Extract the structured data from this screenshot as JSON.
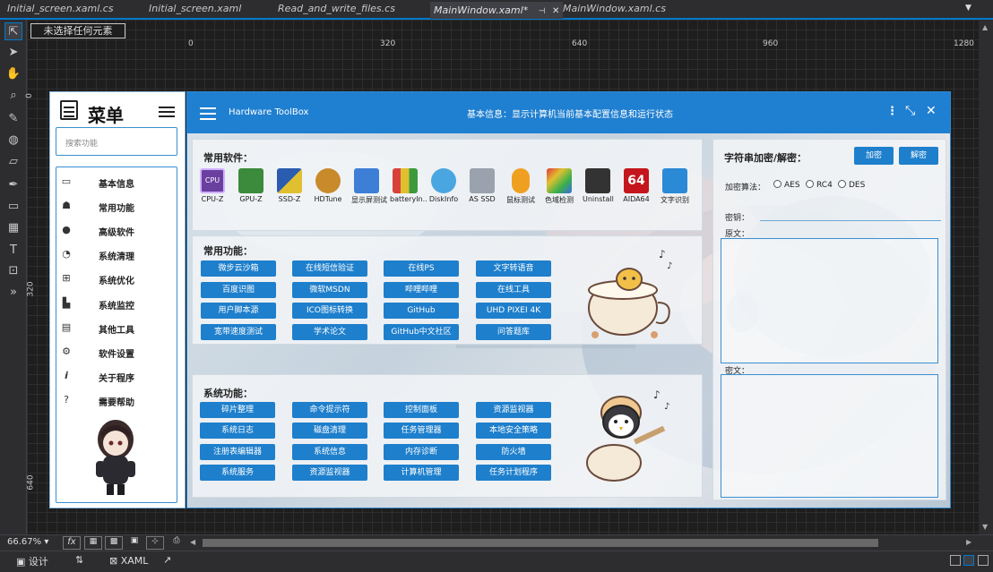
{
  "tabs": [
    {
      "label": "Initial_screen.xaml.cs",
      "active": false
    },
    {
      "label": "Initial_screen.xaml",
      "active": false
    },
    {
      "label": "Read_and_write_files.cs",
      "active": false
    },
    {
      "label": "MainWindow.xaml*",
      "active": true
    },
    {
      "label": "MainWindow.xaml.cs",
      "active": false
    }
  ],
  "selection_status": "未选择任何元素",
  "ruler": {
    "h": [
      "0",
      "320",
      "640",
      "960",
      "1280"
    ],
    "v": [
      "0",
      "320",
      "640"
    ]
  },
  "side_menu": {
    "title": "菜单",
    "search_placeholder": "搜索功能",
    "items": [
      {
        "label": "基本信息",
        "icon": "monitor-icon"
      },
      {
        "label": "常用功能",
        "icon": "android-icon"
      },
      {
        "label": "高级软件",
        "icon": "bug-icon"
      },
      {
        "label": "系统清理",
        "icon": "clean-icon"
      },
      {
        "label": "系统优化",
        "icon": "optimize-icon"
      },
      {
        "label": "系统监控",
        "icon": "monitor-bars-icon"
      },
      {
        "label": "其他工具",
        "icon": "tools-icon"
      },
      {
        "label": "软件设置",
        "icon": "settings-icon"
      },
      {
        "label": "关于程序",
        "icon": "info-icon"
      },
      {
        "label": "需要帮助",
        "icon": "help-icon"
      }
    ]
  },
  "app": {
    "title": "Hardware ToolBox",
    "info": "基本信息：显示计算机当前基本配置信息和运行状态"
  },
  "software": {
    "title": "常用软件：",
    "items": [
      {
        "label": "CPU-Z",
        "color": "#6b3fa0"
      },
      {
        "label": "GPU-Z",
        "color": "#3c8a3c"
      },
      {
        "label": "SSD-Z",
        "color": "#2a5db0"
      },
      {
        "label": "HDTune",
        "color": "#c88a2a"
      },
      {
        "label": "显示屏测试",
        "color": "#3d7fd6"
      },
      {
        "label": "batteryIn..",
        "color": "#d8413a"
      },
      {
        "label": "DiskInfo",
        "color": "#4aa6e0"
      },
      {
        "label": "AS SSD",
        "color": "#9aa3ad"
      },
      {
        "label": "鼠标测试",
        "color": "#f0a020"
      },
      {
        "label": "色域检测",
        "color": "#e0c030"
      },
      {
        "label": "Uninstall",
        "color": "#333333"
      },
      {
        "label": "AIDA64",
        "color": "#c4161c"
      },
      {
        "label": "文字识别",
        "color": "#2a8ad6"
      }
    ]
  },
  "common_functions": {
    "title": "常用功能：",
    "buttons": [
      "微步云沙箱",
      "在线短信验证",
      "在线PS",
      "文字转语音",
      "百度识图",
      "微软MSDN",
      "哔哩哔哩",
      "在线工具",
      "用户脚本源",
      "ICO图标转换",
      "GitHub",
      "UHD PIXEI 4K",
      "宽带速度测试",
      "学术论文",
      "GitHub中文社区",
      "问答题库"
    ]
  },
  "system_functions": {
    "title": "系统功能：",
    "buttons": [
      "碎片整理",
      "命令提示符",
      "控制面板",
      "资源监视器",
      "系统日志",
      "磁盘清理",
      "任务管理器",
      "本地安全策略",
      "注册表编辑器",
      "系统信息",
      "内存诊断",
      "防火墙",
      "系统服务",
      "资源监视器",
      "计算机管理",
      "任务计划程序"
    ]
  },
  "crypto": {
    "title": "字符串加密/解密：",
    "encrypt_label": "加密",
    "decrypt_label": "解密",
    "algorithm_label": "加密算法：",
    "algorithms": [
      "AES",
      "RC4",
      "DES"
    ],
    "key_label": "密钥：",
    "plaintext_label": "原文：",
    "ciphertext_label": "密文："
  },
  "bottom": {
    "zoom": "66.67%",
    "design_tab": "设计",
    "xaml_tab": "XAML"
  },
  "colors": {
    "accent": "#007acc",
    "app_header": "#1f7fd0",
    "button": "#1e7fcc"
  }
}
